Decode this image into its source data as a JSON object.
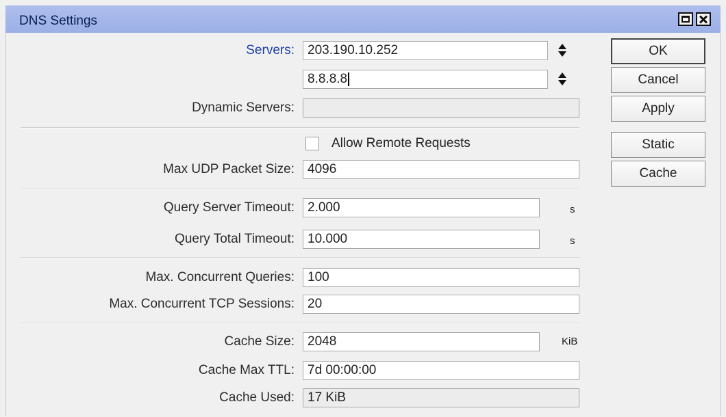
{
  "window": {
    "title": "DNS Settings"
  },
  "servers": {
    "label": "Servers:",
    "items": [
      "203.190.10.252",
      "8.8.8.8"
    ]
  },
  "dynamic_servers": {
    "label": "Dynamic Servers:",
    "value": ""
  },
  "allow_remote_requests": {
    "label": "Allow Remote Requests",
    "checked": false
  },
  "max_udp_packet_size": {
    "label": "Max UDP Packet Size:",
    "value": "4096"
  },
  "query_server_timeout": {
    "label": "Query Server Timeout:",
    "value": "2.000",
    "unit": "s"
  },
  "query_total_timeout": {
    "label": "Query Total Timeout:",
    "value": "10.000",
    "unit": "s"
  },
  "max_concurrent_queries": {
    "label": "Max. Concurrent Queries:",
    "value": "100"
  },
  "max_concurrent_tcp_sessions": {
    "label": "Max. Concurrent TCP Sessions:",
    "value": "20"
  },
  "cache_size": {
    "label": "Cache Size:",
    "value": "2048",
    "unit": "KiB"
  },
  "cache_max_ttl": {
    "label": "Cache Max TTL:",
    "value": "7d 00:00:00"
  },
  "cache_used": {
    "label": "Cache Used:",
    "value": "17 KiB"
  },
  "buttons": {
    "ok": "OK",
    "cancel": "Cancel",
    "apply": "Apply",
    "static": "Static",
    "cache": "Cache"
  },
  "icons": {
    "maximize": "maximize-icon",
    "close": "close-icon",
    "spinner": "up-down-arrows-icon"
  }
}
